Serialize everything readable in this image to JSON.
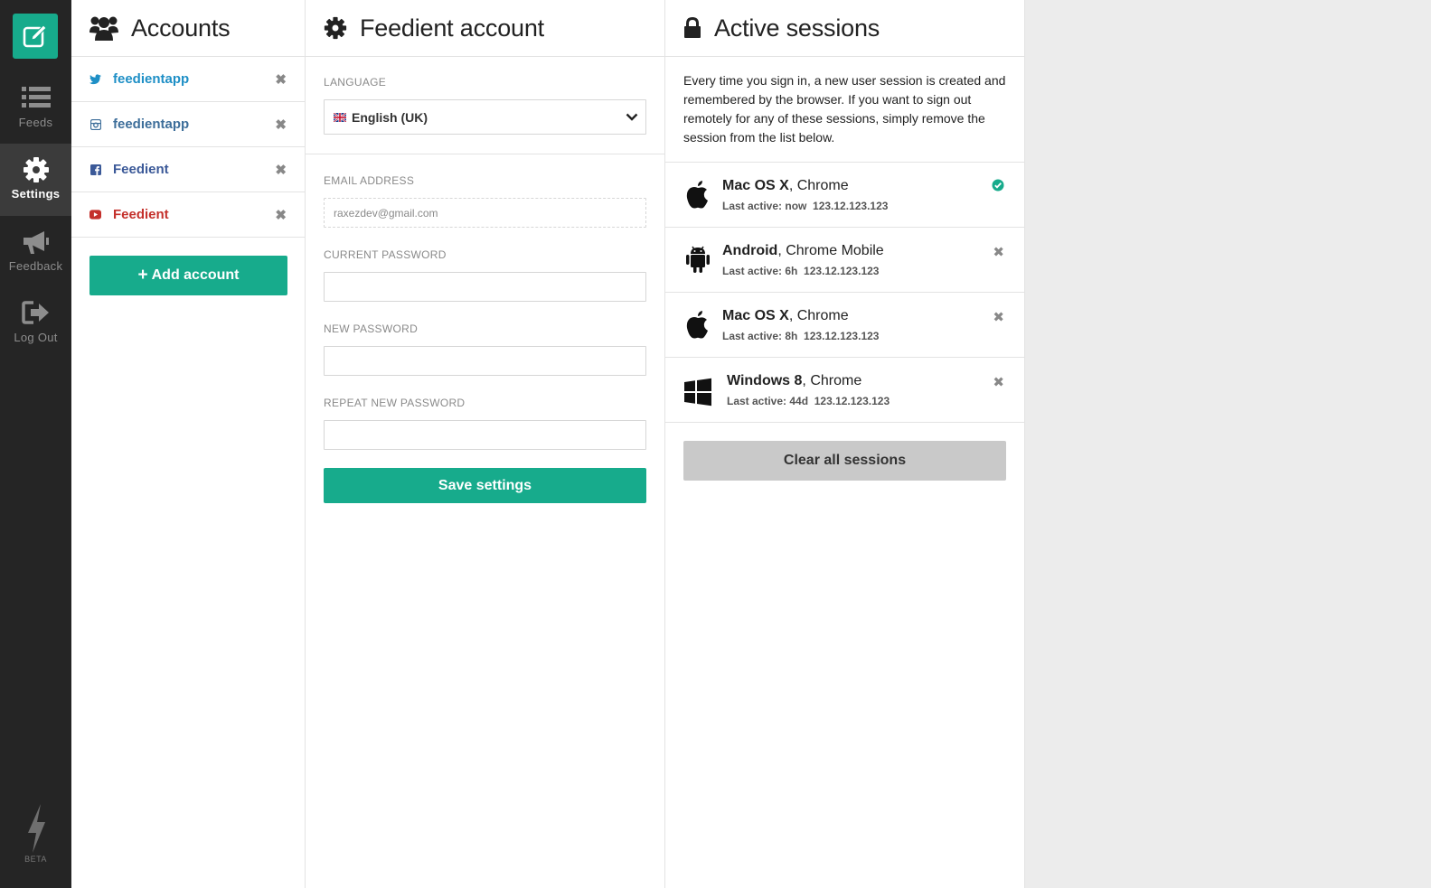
{
  "nav": {
    "items": [
      {
        "label": "Feeds",
        "icon": "list-icon"
      },
      {
        "label": "Settings",
        "icon": "gear-icon",
        "active": true
      },
      {
        "label": "Feedback",
        "icon": "megaphone-icon"
      },
      {
        "label": "Log Out",
        "icon": "logout-icon"
      }
    ],
    "beta": "BETA"
  },
  "accounts": {
    "title": "Accounts",
    "items": [
      {
        "name": "feedientapp",
        "network": "twitter",
        "color": "#1e8fc6"
      },
      {
        "name": "feedientapp",
        "network": "instagram",
        "color": "#3d6e9a"
      },
      {
        "name": "Feedient",
        "network": "facebook",
        "color": "#3b5998"
      },
      {
        "name": "Feedient",
        "network": "youtube",
        "color": "#c4302b"
      }
    ],
    "remove_glyph": "✖",
    "add_label": "Add account",
    "add_glyph": "+"
  },
  "feedient_account": {
    "title": "Feedient account",
    "language_label": "LANGUAGE",
    "language_value": "English (UK)",
    "email_label": "EMAIL ADDRESS",
    "email_value": "raxezdev@gmail.com",
    "current_password_label": "CURRENT PASSWORD",
    "new_password_label": "NEW PASSWORD",
    "repeat_password_label": "REPEAT NEW PASSWORD",
    "save_label": "Save settings"
  },
  "sessions": {
    "title": "Active sessions",
    "description": "Every time you sign in, a new user session is created and remembered by the browser. If you want to sign out remotely for any of these sessions, simply remove the session from the list below.",
    "items": [
      {
        "os": "Mac OS X",
        "browser": ", Chrome",
        "last_active": "Last active: now",
        "ip": "123.12.123.123",
        "icon": "apple-icon",
        "current": true
      },
      {
        "os": "Android",
        "browser": ", Chrome Mobile",
        "last_active": "Last active: 6h",
        "ip": "123.12.123.123",
        "icon": "android-icon",
        "current": false
      },
      {
        "os": "Mac OS X",
        "browser": ", Chrome",
        "last_active": "Last active: 8h",
        "ip": "123.12.123.123",
        "icon": "apple-icon",
        "current": false
      },
      {
        "os": "Windows 8",
        "browser": ", Chrome",
        "last_active": "Last active: 44d",
        "ip": "123.12.123.123",
        "icon": "windows-icon",
        "current": false
      }
    ],
    "remove_glyph": "✖",
    "clear_label": "Clear all sessions"
  },
  "colors": {
    "accent": "#17ab8c",
    "nav_bg": "#252525",
    "clear_button_bg": "#c9c9c9"
  }
}
